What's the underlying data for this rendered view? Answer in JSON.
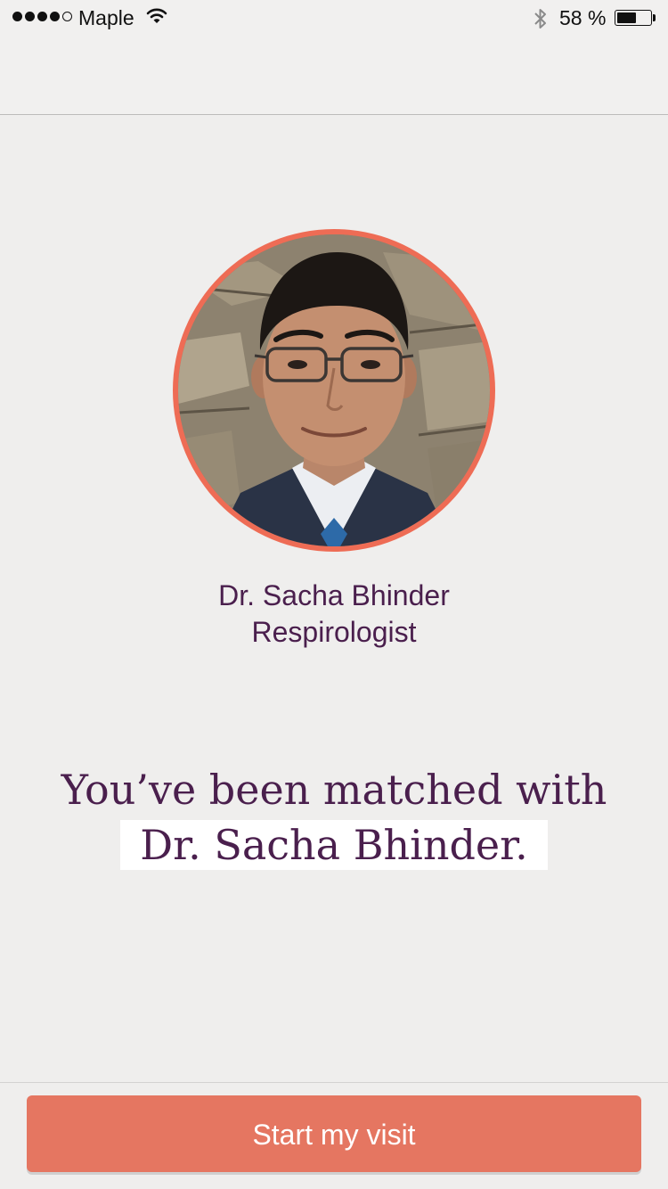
{
  "status_bar": {
    "carrier": "Maple",
    "signal_bars_filled": 4,
    "signal_bars_total": 5,
    "battery_percent_text": "58 %",
    "battery_level": 0.58
  },
  "doctor": {
    "name": "Dr. Sacha Bhinder",
    "specialty": "Respirologist",
    "photo_icon": "doctor-portrait"
  },
  "headline": {
    "line1": "You’ve been matched with",
    "line2": "Dr. Sacha Bhinder."
  },
  "footer": {
    "start_button_label": "Start my visit"
  },
  "colors": {
    "accent": "#e57661",
    "ring": "#ee6c55",
    "text": "#4a1f4d",
    "background": "#efeeed"
  }
}
